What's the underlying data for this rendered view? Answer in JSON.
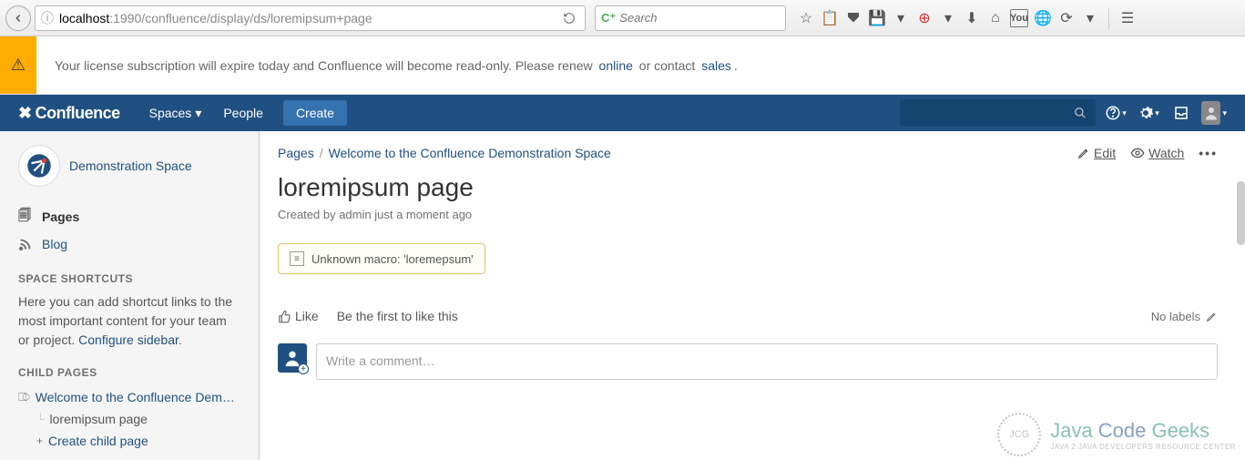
{
  "browser": {
    "url_prefix": "localhost",
    "url_port_path": ":1990/confluence/display/ds/loremipsum+page",
    "search_placeholder": "Search"
  },
  "banner": {
    "text": "Your license subscription will expire today and Confluence will become read-only. Please renew ",
    "online": "online",
    "mid": " or contact ",
    "sales": "sales",
    "end": "."
  },
  "header": {
    "logo": "Confluence",
    "spaces": "Spaces",
    "people": "People",
    "create": "Create"
  },
  "sidebar": {
    "space_name": "Demonstration Space",
    "pages": "Pages",
    "blog": "Blog",
    "shortcuts_title": "SPACE SHORTCUTS",
    "shortcuts_desc_pre": "Here you can add shortcut links to the most important content for your team or project. ",
    "shortcuts_link": "Configure sidebar",
    "shortcuts_desc_post": ".",
    "child_title": "CHILD PAGES",
    "child_welcome": "Welcome to the Confluence Dem…",
    "child_current": "loremipsum page",
    "create_child": "Create child page"
  },
  "content": {
    "bc_pages": "Pages",
    "bc_welcome": "Welcome to the Confluence Demonstration Space",
    "edit": "Edit",
    "watch": "Watch",
    "title": "loremipsum page",
    "meta": "Created by admin just a moment ago",
    "macro": "Unknown macro: 'loremepsum'",
    "like": "Like",
    "like_desc": "Be the first to like this",
    "no_labels": "No labels",
    "comment_placeholder": "Write a comment…"
  },
  "watermark": {
    "circle": "JCG",
    "main1": "Java ",
    "main2": "Code ",
    "main3": "Geeks",
    "sub": "JAVA 2 JAVA DEVELOPERS RESOURCE CENTER"
  }
}
